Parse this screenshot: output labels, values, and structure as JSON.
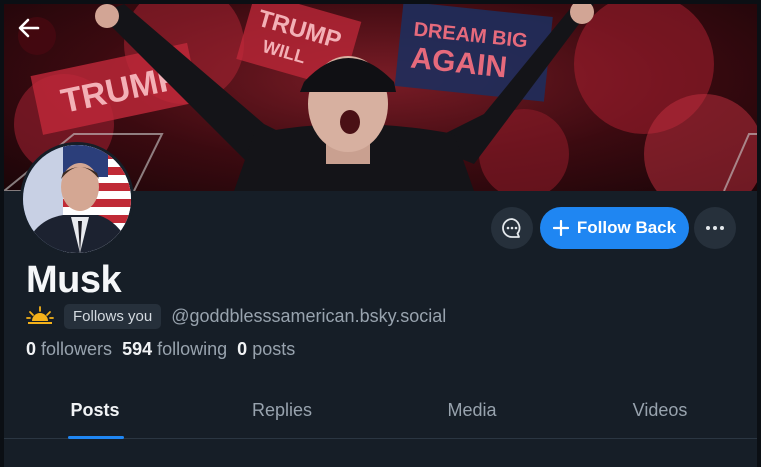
{
  "profile": {
    "display_name": "Musk",
    "follows_you_label": "Follows you",
    "handle": "@goddblesssamerican.bsky.social",
    "followers_count": "0",
    "followers_label": "followers",
    "following_count": "594",
    "following_label": "following",
    "posts_count": "0",
    "posts_label": "posts"
  },
  "banner_signs": {
    "dream_line1": "DREAM BIG",
    "dream_line2": "AGAIN",
    "trump_left": "TRUMP",
    "trump_top": "TRUMP",
    "trump_top2": "WILL"
  },
  "actions": {
    "follow_back_label": "Follow Back"
  },
  "tabs": [
    {
      "label": "Posts",
      "active": true
    },
    {
      "label": "Replies",
      "active": false
    },
    {
      "label": "Media",
      "active": false
    },
    {
      "label": "Videos",
      "active": false
    }
  ],
  "colors": {
    "background": "#161e27",
    "accent": "#1f86f2",
    "button_bg": "#26303b",
    "muted_text": "#98a3ae"
  },
  "icons": {
    "back": "arrow-left-icon",
    "message": "chat-bubble-icon",
    "follow": "plus-icon",
    "more": "ellipsis-icon",
    "badge": "sunrise-icon"
  }
}
